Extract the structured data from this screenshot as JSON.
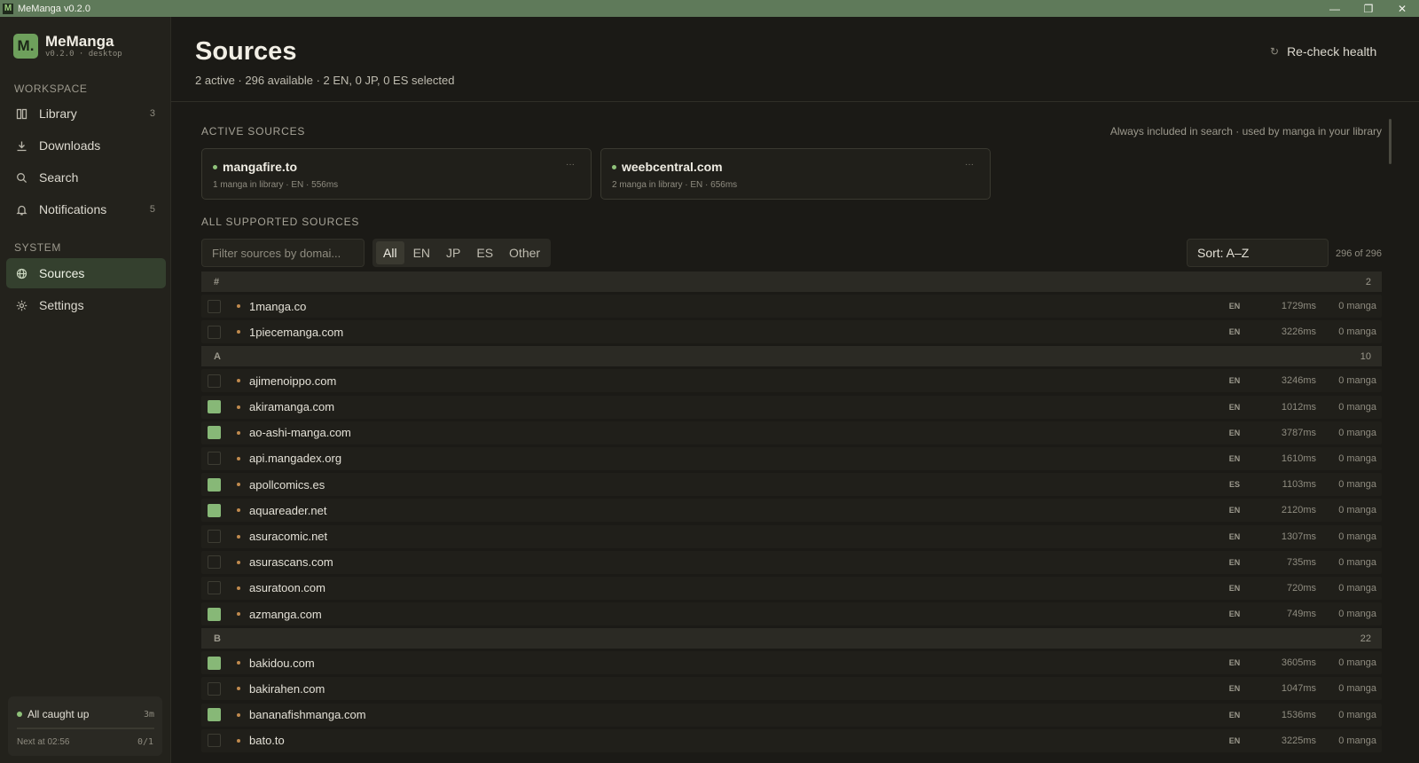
{
  "window": {
    "title": "MeManga v0.2.0",
    "app_icon": "M",
    "controls": {
      "minimize": "—",
      "maximize": "❐",
      "close": "✕"
    }
  },
  "brand": {
    "logo": "M.",
    "name": "MeManga",
    "version": "v0.2.0 · desktop"
  },
  "sidebar": {
    "workspace_label": "WORKSPACE",
    "system_label": "SYSTEM",
    "workspace_items": [
      {
        "label": "Library",
        "icon": "library-icon",
        "count": "3"
      },
      {
        "label": "Downloads",
        "icon": "download-icon",
        "count": ""
      },
      {
        "label": "Search",
        "icon": "search-icon",
        "count": ""
      },
      {
        "label": "Notifications",
        "icon": "bell-icon",
        "count": "5"
      }
    ],
    "system_items": [
      {
        "label": "Sources",
        "icon": "globe-icon",
        "active": true
      },
      {
        "label": "Settings",
        "icon": "gear-icon",
        "active": false
      }
    ],
    "status": {
      "title": "All caught up",
      "ago": "3m",
      "next": "Next at 02:56",
      "count": "0/1",
      "progress": 0
    }
  },
  "header": {
    "title": "Sources",
    "subtitle": "2 active · 296 available · 2 EN, 0 JP, 0 ES selected",
    "recheck_label": "Re-check health",
    "recheck_icon": "refresh-icon"
  },
  "active_sources": {
    "heading": "ACTIVE SOURCES",
    "note": "Always included in search · used by manga in your library",
    "cards": [
      {
        "name": "mangafire.to",
        "meta": "1 manga in library · EN · 556ms",
        "menu": "···"
      },
      {
        "name": "weebcentral.com",
        "meta": "2 manga in library · EN · 656ms",
        "menu": "···"
      }
    ]
  },
  "all_sources": {
    "heading": "ALL SUPPORTED SOURCES",
    "filter_placeholder": "Filter sources by domai...",
    "tabs": [
      {
        "label": "All",
        "active": true
      },
      {
        "label": "EN",
        "active": false
      },
      {
        "label": "JP",
        "active": false
      },
      {
        "label": "ES",
        "active": false
      },
      {
        "label": "Other",
        "active": false
      }
    ],
    "sort_label": "Sort: A–Z",
    "result_count": "296 of 296",
    "groups": [
      {
        "letter": "#",
        "count": "2",
        "rows": [
          {
            "name": "1manga.co",
            "checked": false,
            "lang": "EN",
            "ping": "1729ms",
            "manga": "0 manga"
          },
          {
            "name": "1piecemanga.com",
            "checked": false,
            "lang": "EN",
            "ping": "3226ms",
            "manga": "0 manga"
          }
        ]
      },
      {
        "letter": "A",
        "count": "10",
        "rows": [
          {
            "name": "ajimenoippo.com",
            "checked": false,
            "lang": "EN",
            "ping": "3246ms",
            "manga": "0 manga"
          },
          {
            "name": "akiramanga.com",
            "checked": true,
            "lang": "EN",
            "ping": "1012ms",
            "manga": "0 manga"
          },
          {
            "name": "ao-ashi-manga.com",
            "checked": true,
            "lang": "EN",
            "ping": "3787ms",
            "manga": "0 manga"
          },
          {
            "name": "api.mangadex.org",
            "checked": false,
            "lang": "EN",
            "ping": "1610ms",
            "manga": "0 manga"
          },
          {
            "name": "apollcomics.es",
            "checked": true,
            "lang": "ES",
            "ping": "1103ms",
            "manga": "0 manga"
          },
          {
            "name": "aquareader.net",
            "checked": true,
            "lang": "EN",
            "ping": "2120ms",
            "manga": "0 manga"
          },
          {
            "name": "asuracomic.net",
            "checked": false,
            "lang": "EN",
            "ping": "1307ms",
            "manga": "0 manga"
          },
          {
            "name": "asurascans.com",
            "checked": false,
            "lang": "EN",
            "ping": "735ms",
            "manga": "0 manga"
          },
          {
            "name": "asuratoon.com",
            "checked": false,
            "lang": "EN",
            "ping": "720ms",
            "manga": "0 manga"
          },
          {
            "name": "azmanga.com",
            "checked": true,
            "lang": "EN",
            "ping": "749ms",
            "manga": "0 manga"
          }
        ]
      },
      {
        "letter": "B",
        "count": "22",
        "rows": [
          {
            "name": "bakidou.com",
            "checked": true,
            "lang": "EN",
            "ping": "3605ms",
            "manga": "0 manga"
          },
          {
            "name": "bakirahen.com",
            "checked": false,
            "lang": "EN",
            "ping": "1047ms",
            "manga": "0 manga"
          },
          {
            "name": "bananafishmanga.com",
            "checked": true,
            "lang": "EN",
            "ping": "1536ms",
            "manga": "0 manga"
          },
          {
            "name": "bato.to",
            "checked": false,
            "lang": "EN",
            "ping": "3225ms",
            "manga": "0 manga"
          }
        ]
      }
    ]
  },
  "colors": {
    "accent": "#87b877",
    "active_nav_bg": "#34402e",
    "titlebar": "#5f7a5a",
    "source_dot": "#c08a4e"
  }
}
